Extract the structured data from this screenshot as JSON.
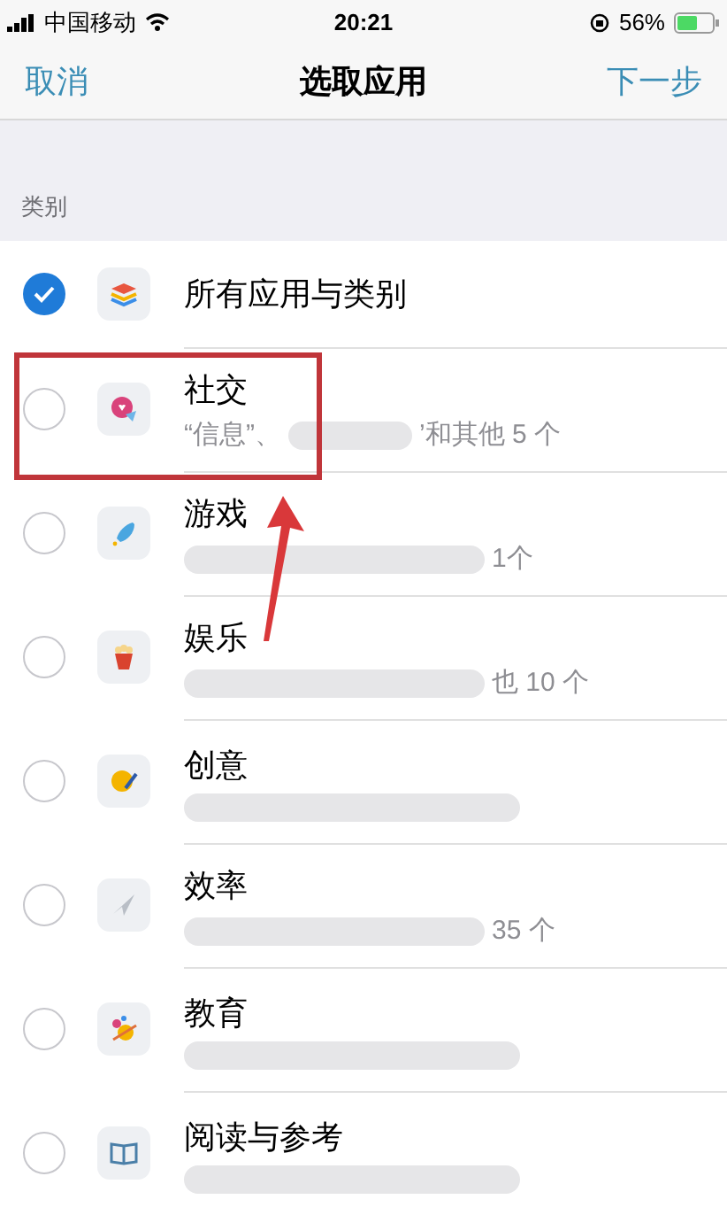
{
  "status_bar": {
    "carrier": "中国移动",
    "time": "20:21",
    "battery": "56%"
  },
  "nav": {
    "cancel": "取消",
    "title": "选取应用",
    "next": "下一步"
  },
  "section": {
    "title": "类别"
  },
  "rows": [
    {
      "title": "所有应用与类别",
      "selected": true
    },
    {
      "title": "社交",
      "selected": false,
      "subtitle_start": "“信息”、",
      "subtitle_end": "’和其他 5 个",
      "highlighted": true
    },
    {
      "title": "游戏",
      "selected": false,
      "subtitle_end": "1个"
    },
    {
      "title": "娱乐",
      "selected": false,
      "subtitle_end": "也 10 个"
    },
    {
      "title": "创意",
      "selected": false
    },
    {
      "title": "效率",
      "selected": false,
      "subtitle_end": "35 个"
    },
    {
      "title": "教育",
      "selected": false
    },
    {
      "title": "阅读与参考",
      "selected": false
    }
  ]
}
